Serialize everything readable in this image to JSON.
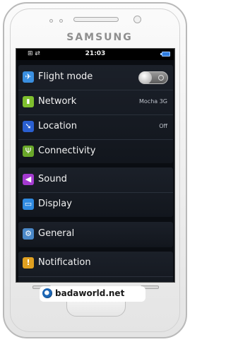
{
  "device": {
    "brand": "SAMSUNG"
  },
  "statusbar": {
    "left_icons": "⊞ ⇄",
    "time": "21:03"
  },
  "settings": {
    "items": [
      {
        "label": "Flight mode",
        "value": "",
        "icon": "airplane-icon",
        "color": "#3a8fe0"
      },
      {
        "label": "Network",
        "value": "Mocha 3G",
        "icon": "network-signal-icon",
        "color": "#7fbf2e"
      },
      {
        "label": "Location",
        "value": "Off",
        "icon": "compass-icon",
        "color": "#2a5fd0"
      },
      {
        "label": "Connectivity",
        "value": "",
        "icon": "usb-icon",
        "color": "#6aa82a"
      },
      {
        "label": "Sound",
        "value": "",
        "icon": "speaker-icon",
        "color": "#a43ad0"
      },
      {
        "label": "Display",
        "value": "",
        "icon": "monitor-icon",
        "color": "#2f8ae0"
      },
      {
        "label": "General",
        "value": "",
        "icon": "gear-icon",
        "color": "#4a88c8"
      },
      {
        "label": "Notification",
        "value": "",
        "icon": "exclamation-icon",
        "color": "#e0a020"
      }
    ]
  },
  "watermark": {
    "text": "badaworld.net"
  }
}
